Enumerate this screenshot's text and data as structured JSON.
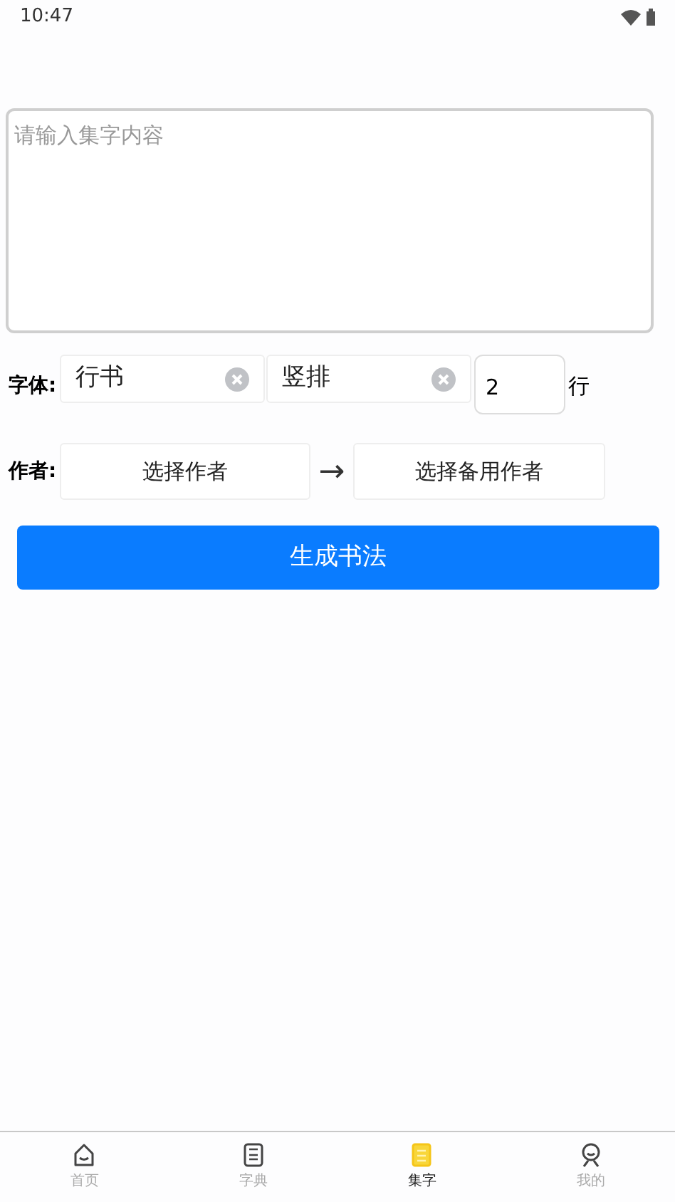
{
  "status_bar": {
    "time": "10:47"
  },
  "content_field": {
    "placeholder": "请输入集字内容"
  },
  "font_row": {
    "label": "字体:",
    "style": "行书",
    "layout": "竖排",
    "rows": "2",
    "rows_unit": "行"
  },
  "author_row": {
    "label": "作者:",
    "author": "选择作者",
    "arrow": "→",
    "backup_author": "选择备用作者"
  },
  "generate_button": "生成书法",
  "tabs": [
    {
      "label": "首页",
      "selected": false
    },
    {
      "label": "字典",
      "selected": false
    },
    {
      "label": "集字",
      "selected": true
    },
    {
      "label": "我的",
      "selected": false
    }
  ]
}
